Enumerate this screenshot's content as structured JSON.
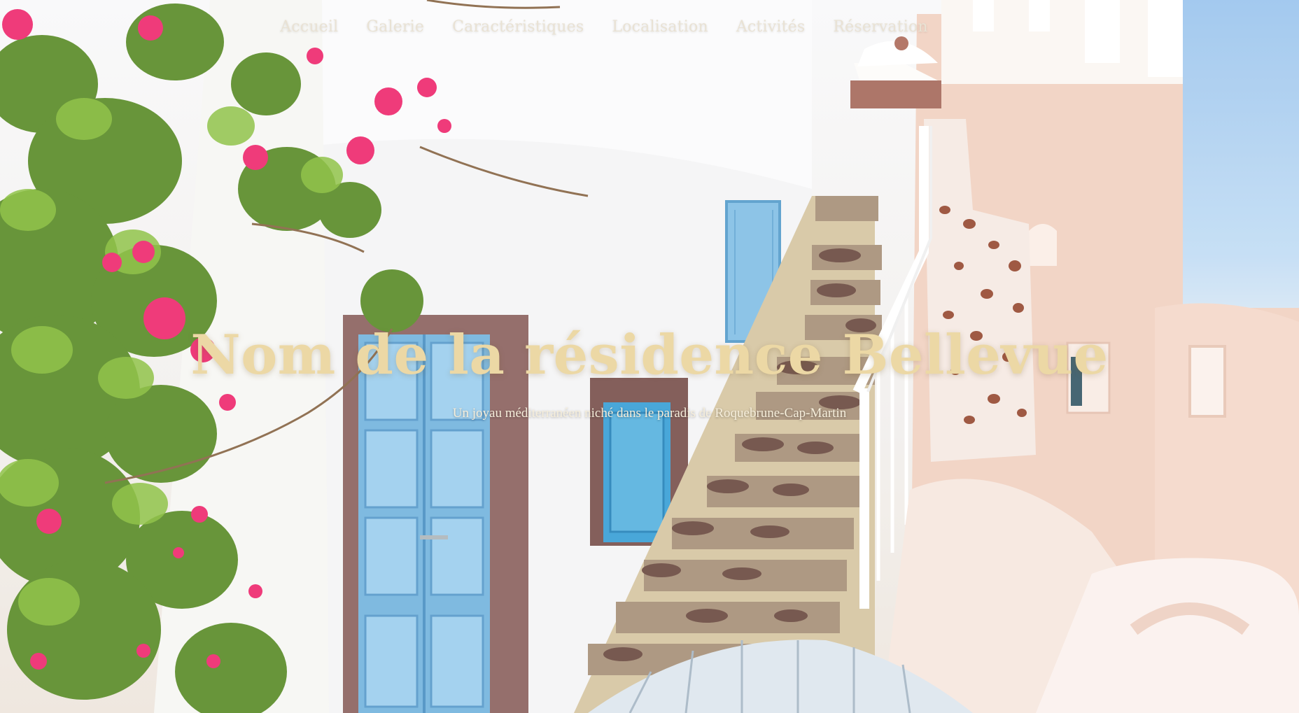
{
  "nav": {
    "items": [
      {
        "label": "Accueil"
      },
      {
        "label": "Galerie"
      },
      {
        "label": "Caractéristiques"
      },
      {
        "label": "Localisation"
      },
      {
        "label": "Activités"
      },
      {
        "label": "Réservation"
      }
    ]
  },
  "hero": {
    "title": "Nom de la résidence Bellevue",
    "subtitle": "Un joyau méditerranéen niché dans le paradis de Roquebrune-Cap-Martin"
  },
  "colors": {
    "title": "#ecd8a5",
    "nav_text": "#e9e2d4",
    "door_blue": "#74b7df",
    "bougainvillea": "#ee2f72",
    "wall_pink": "#f2d0c0"
  }
}
